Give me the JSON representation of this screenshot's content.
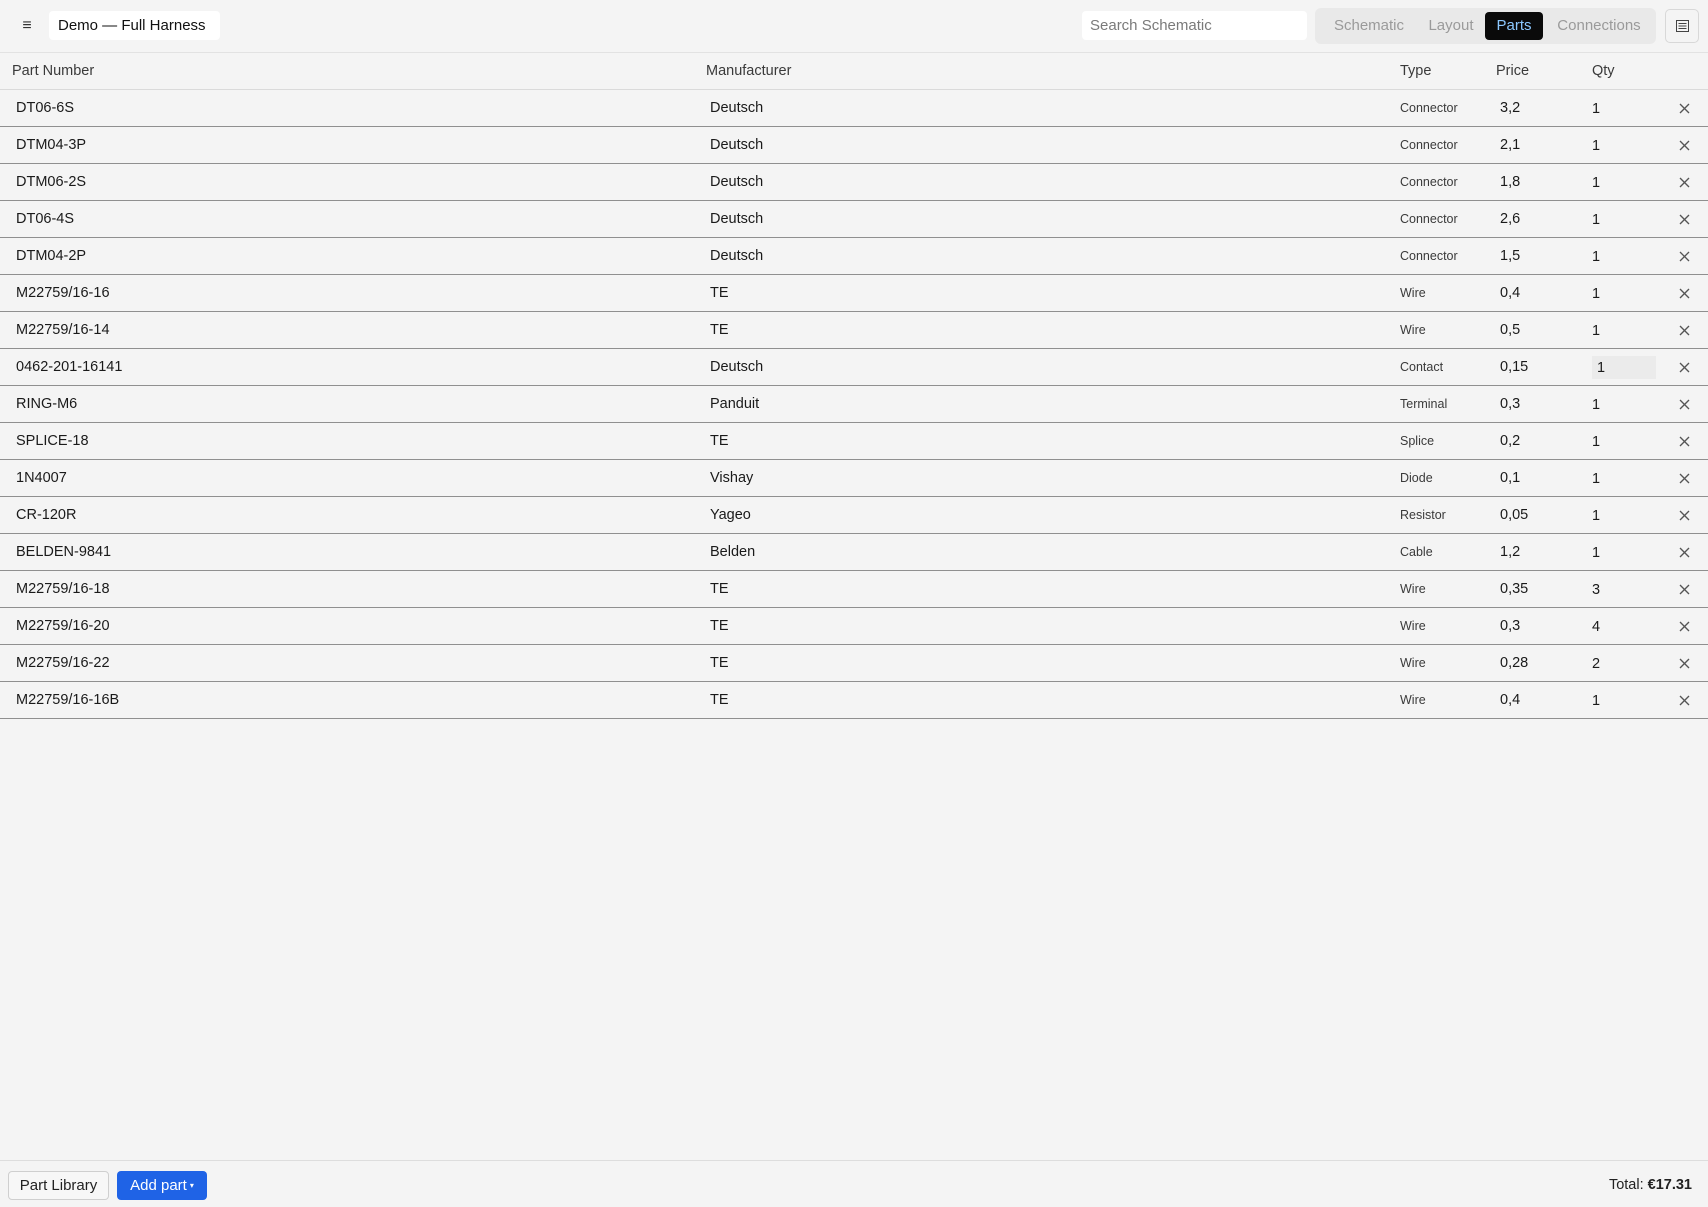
{
  "header": {
    "menu_icon": "hamburger-icon",
    "document_title": "Demo — Full Harness",
    "search_placeholder": "Search Schematic",
    "tabs": [
      {
        "label": "Schematic",
        "active": false
      },
      {
        "label": "Layout",
        "active": false
      },
      {
        "label": "Parts",
        "active": true
      },
      {
        "label": "Connections",
        "active": false
      }
    ],
    "panel_toggle_icon": "panel-list-icon"
  },
  "table": {
    "columns": {
      "part_number": "Part Number",
      "manufacturer": "Manufacturer",
      "type": "Type",
      "price": "Price",
      "qty": "Qty"
    },
    "rows": [
      {
        "part_number": "DT06-6S",
        "manufacturer": "Deutsch",
        "type": "Connector",
        "price": "3,2",
        "qty": "1"
      },
      {
        "part_number": "DTM04-3P",
        "manufacturer": "Deutsch",
        "type": "Connector",
        "price": "2,1",
        "qty": "1"
      },
      {
        "part_number": "DTM06-2S",
        "manufacturer": "Deutsch",
        "type": "Connector",
        "price": "1,8",
        "qty": "1"
      },
      {
        "part_number": "DT06-4S",
        "manufacturer": "Deutsch",
        "type": "Connector",
        "price": "2,6",
        "qty": "1"
      },
      {
        "part_number": "DTM04-2P",
        "manufacturer": "Deutsch",
        "type": "Connector",
        "price": "1,5",
        "qty": "1"
      },
      {
        "part_number": "M22759/16-16",
        "manufacturer": "TE",
        "type": "Wire",
        "price": "0,4",
        "qty": "1"
      },
      {
        "part_number": "M22759/16-14",
        "manufacturer": "TE",
        "type": "Wire",
        "price": "0,5",
        "qty": "1"
      },
      {
        "part_number": "0462-201-16141",
        "manufacturer": "Deutsch",
        "type": "Contact",
        "price": "0,15",
        "qty": "1",
        "qty_focused": true
      },
      {
        "part_number": "RING-M6",
        "manufacturer": "Panduit",
        "type": "Terminal",
        "price": "0,3",
        "qty": "1"
      },
      {
        "part_number": "SPLICE-18",
        "manufacturer": "TE",
        "type": "Splice",
        "price": "0,2",
        "qty": "1"
      },
      {
        "part_number": "1N4007",
        "manufacturer": "Vishay",
        "type": "Diode",
        "price": "0,1",
        "qty": "1"
      },
      {
        "part_number": "CR-120R",
        "manufacturer": "Yageo",
        "type": "Resistor",
        "price": "0,05",
        "qty": "1"
      },
      {
        "part_number": "BELDEN-9841",
        "manufacturer": "Belden",
        "type": "Cable",
        "price": "1,2",
        "qty": "1"
      },
      {
        "part_number": "M22759/16-18",
        "manufacturer": "TE",
        "type": "Wire",
        "price": "0,35",
        "qty": "3"
      },
      {
        "part_number": "M22759/16-20",
        "manufacturer": "TE",
        "type": "Wire",
        "price": "0,3",
        "qty": "4"
      },
      {
        "part_number": "M22759/16-22",
        "manufacturer": "TE",
        "type": "Wire",
        "price": "0,28",
        "qty": "2"
      },
      {
        "part_number": "M22759/16-16B",
        "manufacturer": "TE",
        "type": "Wire",
        "price": "0,4",
        "qty": "1"
      }
    ],
    "delete_icon": "close-icon"
  },
  "footer": {
    "part_library_label": "Part Library",
    "add_part_label": "Add part",
    "add_part_caret": "▾",
    "total_label": "Total:",
    "total_value": "€17.31"
  },
  "colors": {
    "background": "#f4f4f4",
    "active_tab_bg": "#0a0a0a",
    "active_tab_text": "#8cc8ff",
    "primary_button": "#1f63e6"
  }
}
